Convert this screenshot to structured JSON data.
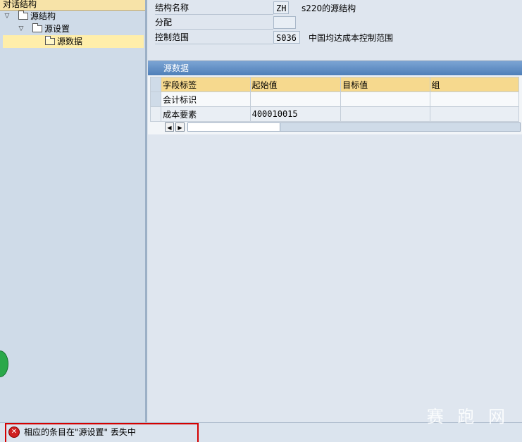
{
  "tree": {
    "header": "对话结构",
    "items": [
      {
        "label": "源结构",
        "expanded": true
      },
      {
        "label": "源设置",
        "expanded": true
      },
      {
        "label": "源数据",
        "selected": true
      }
    ]
  },
  "form": {
    "structure_name": {
      "label": "结构名称",
      "code": "ZH",
      "desc": "s220的源结构"
    },
    "assignment": {
      "label": "分配",
      "code": ""
    },
    "controlling_area": {
      "label": "控制范围",
      "code": "S036",
      "desc": "中国均达成本控制范围"
    }
  },
  "table": {
    "title": "源数据",
    "columns": [
      "字段标签",
      "起始值",
      "目标值",
      "组"
    ],
    "rows": [
      [
        "会计标识",
        "",
        "",
        ""
      ],
      [
        "成本要素",
        "400010015",
        "",
        ""
      ]
    ]
  },
  "status": {
    "message": "相应的条目在\"源设置\" 丢失中"
  },
  "watermark": "赛 跑 网"
}
